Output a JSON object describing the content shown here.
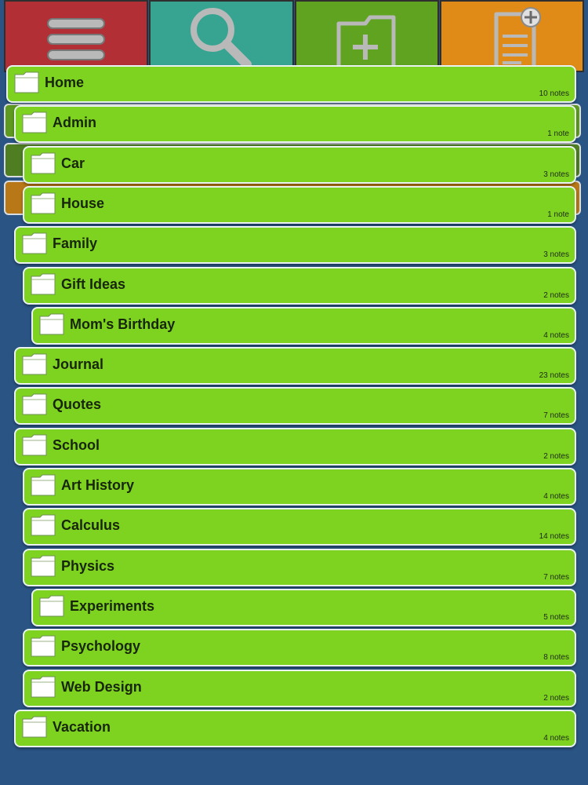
{
  "toolbar": {
    "menu_icon": "hamburger-menu-icon",
    "search_icon": "magnifier-search-icon",
    "new_folder_icon": "folder-plus-icon",
    "new_note_icon": "note-plus-icon"
  },
  "colors": {
    "background": "#2a5484",
    "row": "#7ed321",
    "menu_tile": "#b12f35",
    "search_tile": "#37a491",
    "new_folder_tile": "#5fa320",
    "new_note_tile": "#e08b17"
  },
  "folders": [
    {
      "name": "Home",
      "count": "10 notes",
      "depth": 0
    },
    {
      "name": "Admin",
      "count": "1 note",
      "depth": 1
    },
    {
      "name": "Car",
      "count": "3 notes",
      "depth": 2
    },
    {
      "name": "House",
      "count": "1 note",
      "depth": 2
    },
    {
      "name": "Family",
      "count": "3 notes",
      "depth": 1
    },
    {
      "name": "Gift Ideas",
      "count": "2 notes",
      "depth": 2
    },
    {
      "name": "Mom's Birthday",
      "count": "4 notes",
      "depth": 3
    },
    {
      "name": "Journal",
      "count": "23 notes",
      "depth": 1
    },
    {
      "name": "Quotes",
      "count": "7 notes",
      "depth": 1
    },
    {
      "name": "School",
      "count": "2 notes",
      "depth": 1
    },
    {
      "name": "Art History",
      "count": "4 notes",
      "depth": 2
    },
    {
      "name": "Calculus",
      "count": "14 notes",
      "depth": 2
    },
    {
      "name": "Physics",
      "count": "7 notes",
      "depth": 2
    },
    {
      "name": "Experiments",
      "count": "5 notes",
      "depth": 3
    },
    {
      "name": "Psychology",
      "count": "8 notes",
      "depth": 2
    },
    {
      "name": "Web Design",
      "count": "2 notes",
      "depth": 2
    },
    {
      "name": "Vacation",
      "count": "4 notes",
      "depth": 1
    }
  ]
}
